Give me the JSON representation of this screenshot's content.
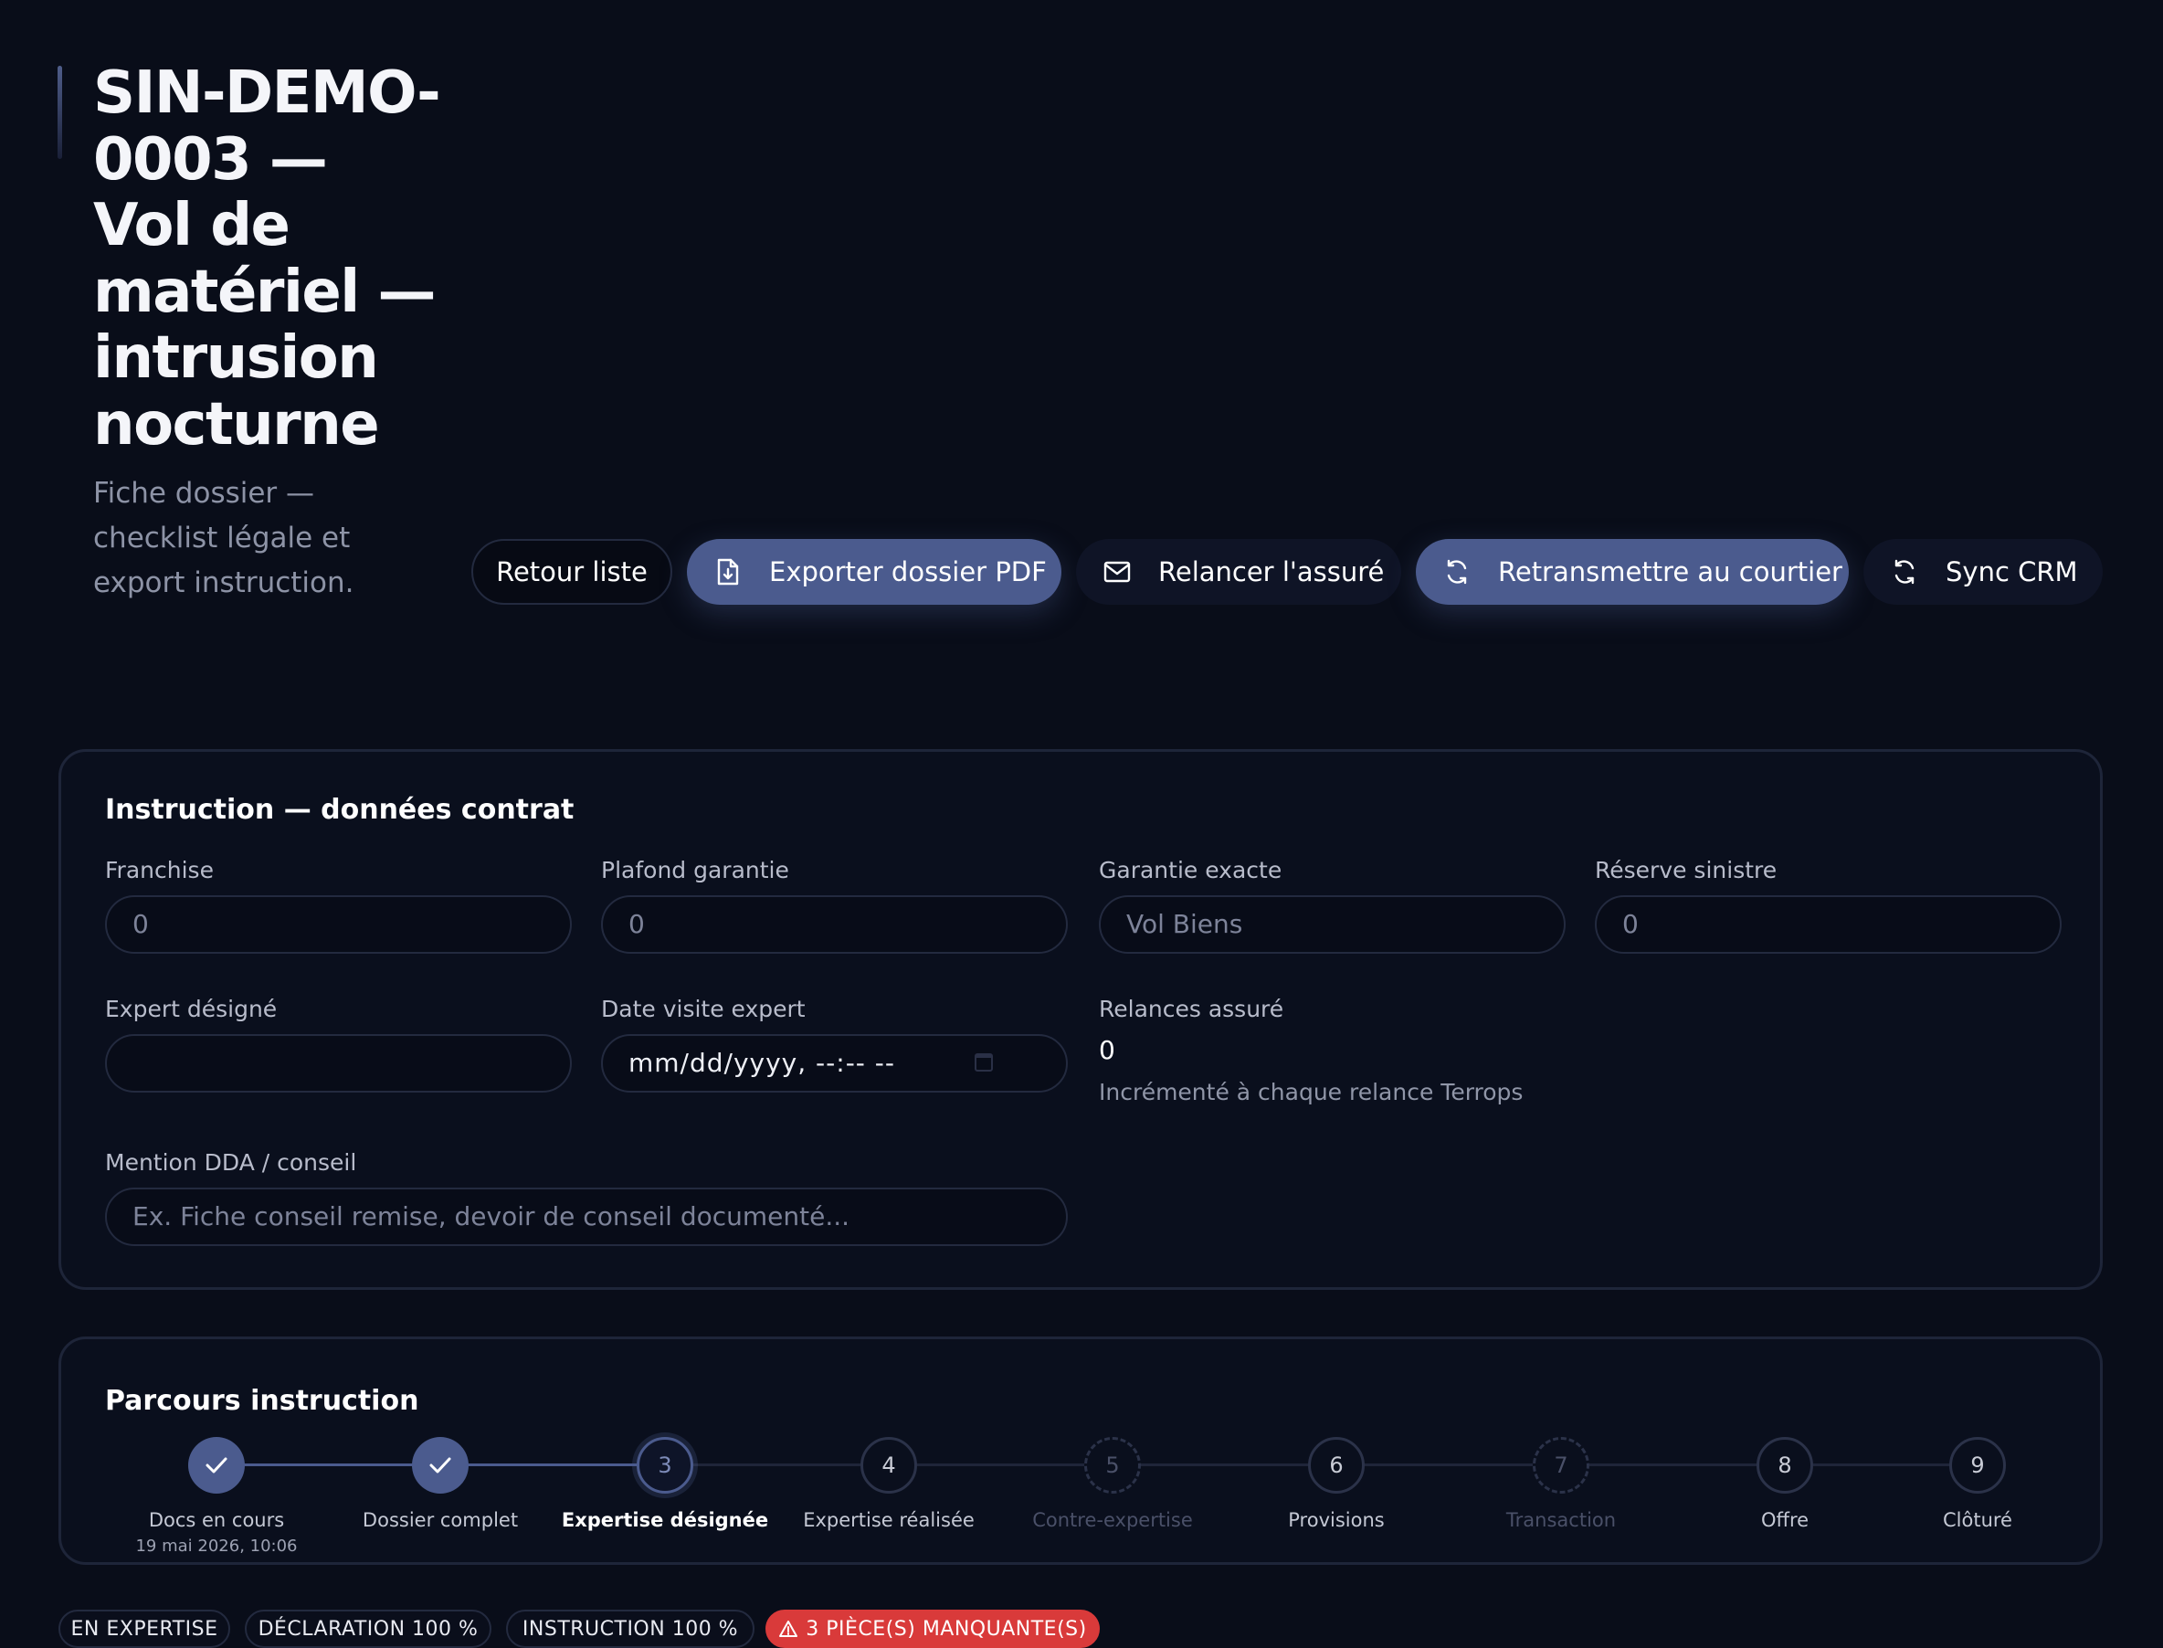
{
  "header": {
    "title": "SIN-DEMO-0003 — Vol de matériel — intrusion nocturne",
    "subtitle": "Fiche dossier — checklist légale et export instruction."
  },
  "actions": {
    "back": "Retour liste",
    "export_pdf": "Exporter dossier PDF",
    "remind": "Relancer l'assuré",
    "retransmit": "Retransmettre au courtier",
    "sync": "Sync CRM"
  },
  "instruction": {
    "title": "Instruction — données contrat",
    "franchise": {
      "label": "Franchise",
      "placeholder": "0"
    },
    "plafond": {
      "label": "Plafond garantie",
      "placeholder": "0"
    },
    "garantie": {
      "label": "Garantie exacte",
      "placeholder": "Vol Biens"
    },
    "reserve": {
      "label": "Réserve sinistre",
      "placeholder": "0"
    },
    "expert": {
      "label": "Expert désigné",
      "value": ""
    },
    "visit_date": {
      "label": "Date visite expert",
      "value": "mm/dd/yyyy, --:-- --"
    },
    "relances": {
      "label": "Relances assuré",
      "value": "0",
      "hint": "Incrémenté à chaque relance Terrops"
    },
    "mention": {
      "label": "Mention DDA / conseil",
      "placeholder": "Ex. Fiche conseil remise, devoir de conseil documenté..."
    }
  },
  "parcours": {
    "title": "Parcours instruction",
    "steps": [
      {
        "number": "1",
        "label": "Docs en cours",
        "date": "19 mai 2026, 10:06",
        "state": "done"
      },
      {
        "number": "2",
        "label": "Dossier complet",
        "state": "done"
      },
      {
        "number": "3",
        "label": "Expertise désignée",
        "state": "current"
      },
      {
        "number": "4",
        "label": "Expertise réalisée",
        "state": "todo"
      },
      {
        "number": "5",
        "label": "Contre-expertise",
        "state": "skipped"
      },
      {
        "number": "6",
        "label": "Provisions",
        "state": "todo"
      },
      {
        "number": "7",
        "label": "Transaction",
        "state": "skipped"
      },
      {
        "number": "8",
        "label": "Offre",
        "state": "todo"
      },
      {
        "number": "9",
        "label": "Clôturé",
        "state": "todo"
      }
    ]
  },
  "badges": {
    "status": "EN EXPERTISE",
    "declaration": "DÉCLARATION 100 %",
    "instruction": "INSTRUCTION 100 %",
    "missing": "3 PIÈCE(S) MANQUANTE(S)"
  },
  "colors": {
    "background": "#090d19",
    "primary": "#4b5b8e",
    "alert": "#d93a3a"
  },
  "icons": {
    "export_pdf": "file-download-icon",
    "remind": "mail-icon",
    "retransmit": "refresh-icon",
    "sync": "refresh-icon",
    "step_done": "check-icon",
    "missing": "warning-icon",
    "visit_date": "calendar-icon"
  }
}
